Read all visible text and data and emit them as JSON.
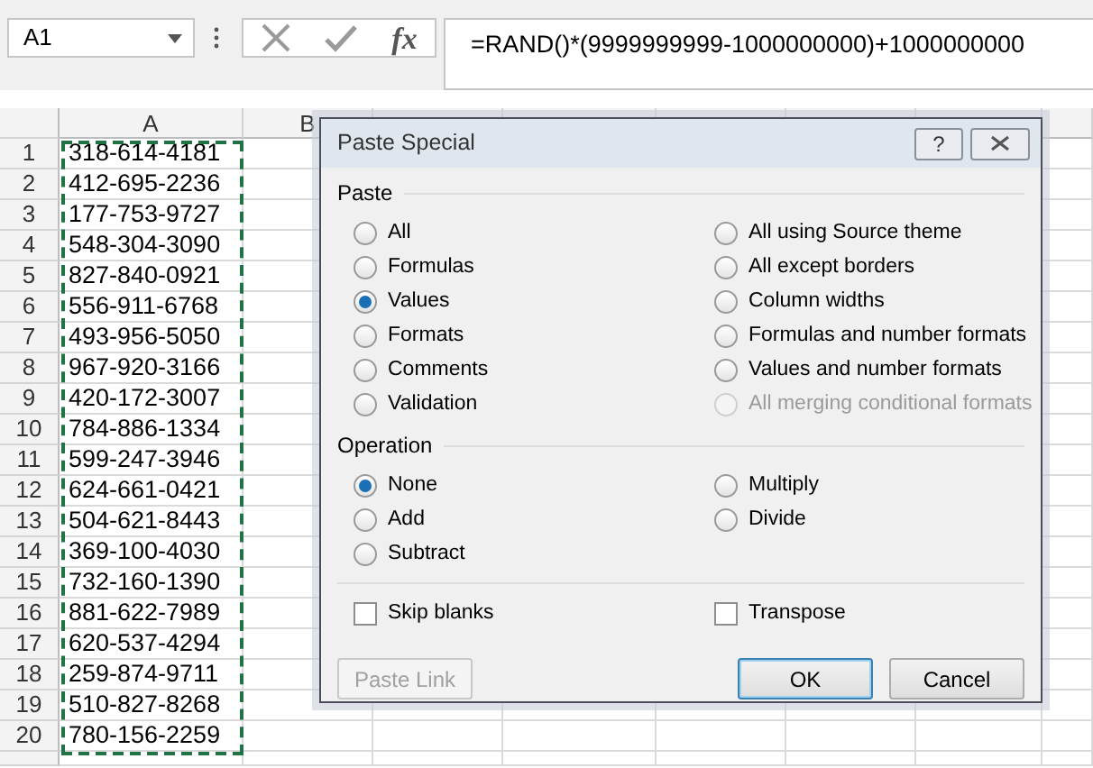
{
  "formula_bar": {
    "name_box": "A1",
    "function_label": "fx",
    "formula": "=RAND()*(9999999999-1000000000)+1000000000"
  },
  "sheet": {
    "columns": [
      "A",
      "B"
    ],
    "rows": [
      {
        "number": "1",
        "cell": "318-614-4181"
      },
      {
        "number": "2",
        "cell": "412-695-2236"
      },
      {
        "number": "3",
        "cell": "177-753-9727"
      },
      {
        "number": "4",
        "cell": "548-304-3090"
      },
      {
        "number": "5",
        "cell": "827-840-0921"
      },
      {
        "number": "6",
        "cell": "556-911-6768"
      },
      {
        "number": "7",
        "cell": "493-956-5050"
      },
      {
        "number": "8",
        "cell": "967-920-3166"
      },
      {
        "number": "9",
        "cell": "420-172-3007"
      },
      {
        "number": "10",
        "cell": "784-886-1334"
      },
      {
        "number": "11",
        "cell": "599-247-3946"
      },
      {
        "number": "12",
        "cell": "624-661-0421"
      },
      {
        "number": "13",
        "cell": "504-621-8443"
      },
      {
        "number": "14",
        "cell": "369-100-4030"
      },
      {
        "number": "15",
        "cell": "732-160-1390"
      },
      {
        "number": "16",
        "cell": "881-622-7989"
      },
      {
        "number": "17",
        "cell": "620-537-4294"
      },
      {
        "number": "18",
        "cell": "259-874-9711"
      },
      {
        "number": "19",
        "cell": "510-827-8268"
      },
      {
        "number": "20",
        "cell": "780-156-2259"
      }
    ]
  },
  "dialog": {
    "title": "Paste Special",
    "help": "?",
    "paste": {
      "label": "Paste",
      "options": [
        {
          "label": "All",
          "selected": false,
          "disabled": false
        },
        {
          "label": "Formulas",
          "selected": false,
          "disabled": false
        },
        {
          "label": "Values",
          "selected": true,
          "disabled": false
        },
        {
          "label": "Formats",
          "selected": false,
          "disabled": false
        },
        {
          "label": "Comments",
          "selected": false,
          "disabled": false
        },
        {
          "label": "Validation",
          "selected": false,
          "disabled": false
        },
        {
          "label": "All using Source theme",
          "selected": false,
          "disabled": false
        },
        {
          "label": "All except borders",
          "selected": false,
          "disabled": false
        },
        {
          "label": "Column widths",
          "selected": false,
          "disabled": false
        },
        {
          "label": "Formulas and number formats",
          "selected": false,
          "disabled": false
        },
        {
          "label": "Values and number formats",
          "selected": false,
          "disabled": false
        },
        {
          "label": "All merging conditional formats",
          "selected": false,
          "disabled": true
        }
      ]
    },
    "operation": {
      "label": "Operation",
      "options": [
        {
          "label": "None",
          "selected": true,
          "disabled": false
        },
        {
          "label": "Add",
          "selected": false,
          "disabled": false
        },
        {
          "label": "Subtract",
          "selected": false,
          "disabled": false
        },
        {
          "label": "Multiply",
          "selected": false,
          "disabled": false
        },
        {
          "label": "Divide",
          "selected": false,
          "disabled": false
        }
      ]
    },
    "checkboxes": [
      {
        "label": "Skip blanks",
        "checked": false
      },
      {
        "label": "Transpose",
        "checked": false
      }
    ],
    "buttons": [
      {
        "label": "Paste Link",
        "kind": "link",
        "disabled": true
      },
      {
        "label": "OK",
        "kind": "default",
        "disabled": false
      },
      {
        "label": "Cancel",
        "kind": "normal",
        "disabled": false
      }
    ]
  }
}
